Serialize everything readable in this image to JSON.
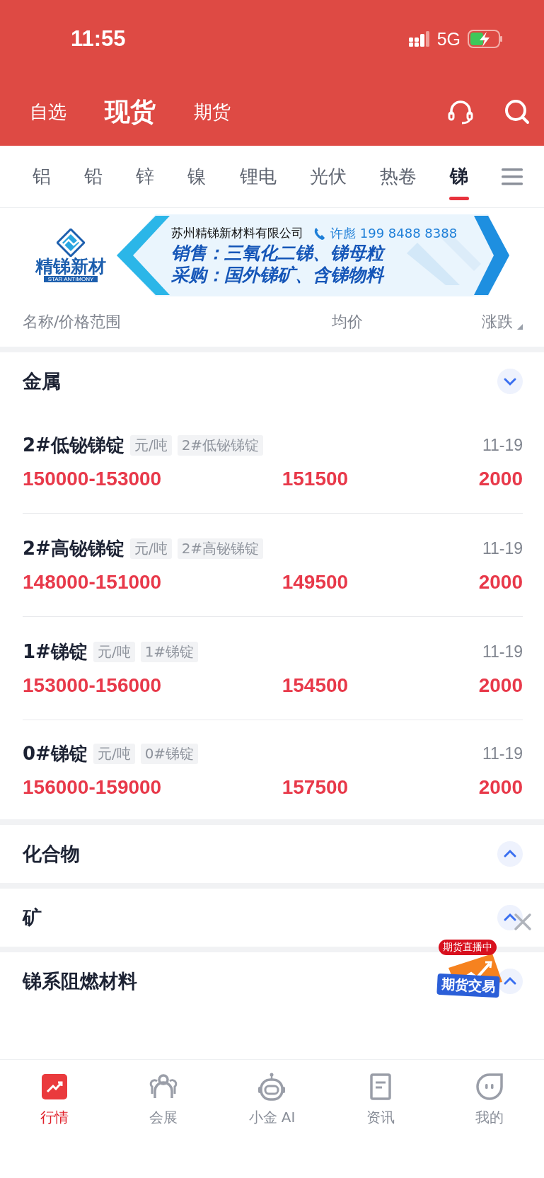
{
  "status_bar": {
    "time": "11:55",
    "network": "5G"
  },
  "header_tabs": [
    {
      "label": "自选",
      "selected": false
    },
    {
      "label": "现货",
      "selected": true
    },
    {
      "label": "期货",
      "selected": false
    }
  ],
  "category_tabs": [
    {
      "label": "铝",
      "selected": false
    },
    {
      "label": "铅",
      "selected": false
    },
    {
      "label": "锌",
      "selected": false
    },
    {
      "label": "镍",
      "selected": false
    },
    {
      "label": "锂电",
      "selected": false
    },
    {
      "label": "光伏",
      "selected": false
    },
    {
      "label": "热卷",
      "selected": false
    },
    {
      "label": "锑",
      "selected": true
    }
  ],
  "banner": {
    "logo_text": "精锑新材",
    "logo_subtext": "STAR ANTIMONY",
    "company": "苏州精锑新材料有限公司",
    "contact": "许彪 199 8488 8388",
    "lines": [
      "销售：三氧化二锑、锑母粒",
      "采购：国外锑矿、含锑物料"
    ]
  },
  "table": {
    "columns": [
      "名称/价格范围",
      "均价",
      "涨跌"
    ]
  },
  "sections": [
    {
      "title": "金属",
      "expanded": true,
      "rows": [
        {
          "name": "2#低铋锑锭",
          "unit": "元/吨",
          "alias": "2#低铋锑锭",
          "date": "11-19",
          "range": "150000-153000",
          "average": "151500",
          "change": "2000"
        },
        {
          "name": "2#高铋锑锭",
          "unit": "元/吨",
          "alias": "2#高铋锑锭",
          "date": "11-19",
          "range": "148000-151000",
          "average": "149500",
          "change": "2000"
        },
        {
          "name": "1#锑锭",
          "unit": "元/吨",
          "alias": "1#锑锭",
          "date": "11-19",
          "range": "153000-156000",
          "average": "154500",
          "change": "2000"
        },
        {
          "name": "0#锑锭",
          "unit": "元/吨",
          "alias": "0#锑锭",
          "date": "11-19",
          "range": "156000-159000",
          "average": "157500",
          "change": "2000"
        }
      ]
    },
    {
      "title": "化合物",
      "expanded": false
    },
    {
      "title": "矿",
      "expanded": false
    },
    {
      "title": "锑系阻燃材料",
      "expanded": false
    }
  ],
  "floating_ad": {
    "badge": "期货直播中",
    "label": "期货交易"
  },
  "bottom_nav": [
    {
      "label": "行情",
      "selected": true
    },
    {
      "label": "会展",
      "selected": false
    },
    {
      "label": "小金 AI",
      "selected": false
    },
    {
      "label": "资讯",
      "selected": false
    },
    {
      "label": "我的",
      "selected": false
    }
  ]
}
